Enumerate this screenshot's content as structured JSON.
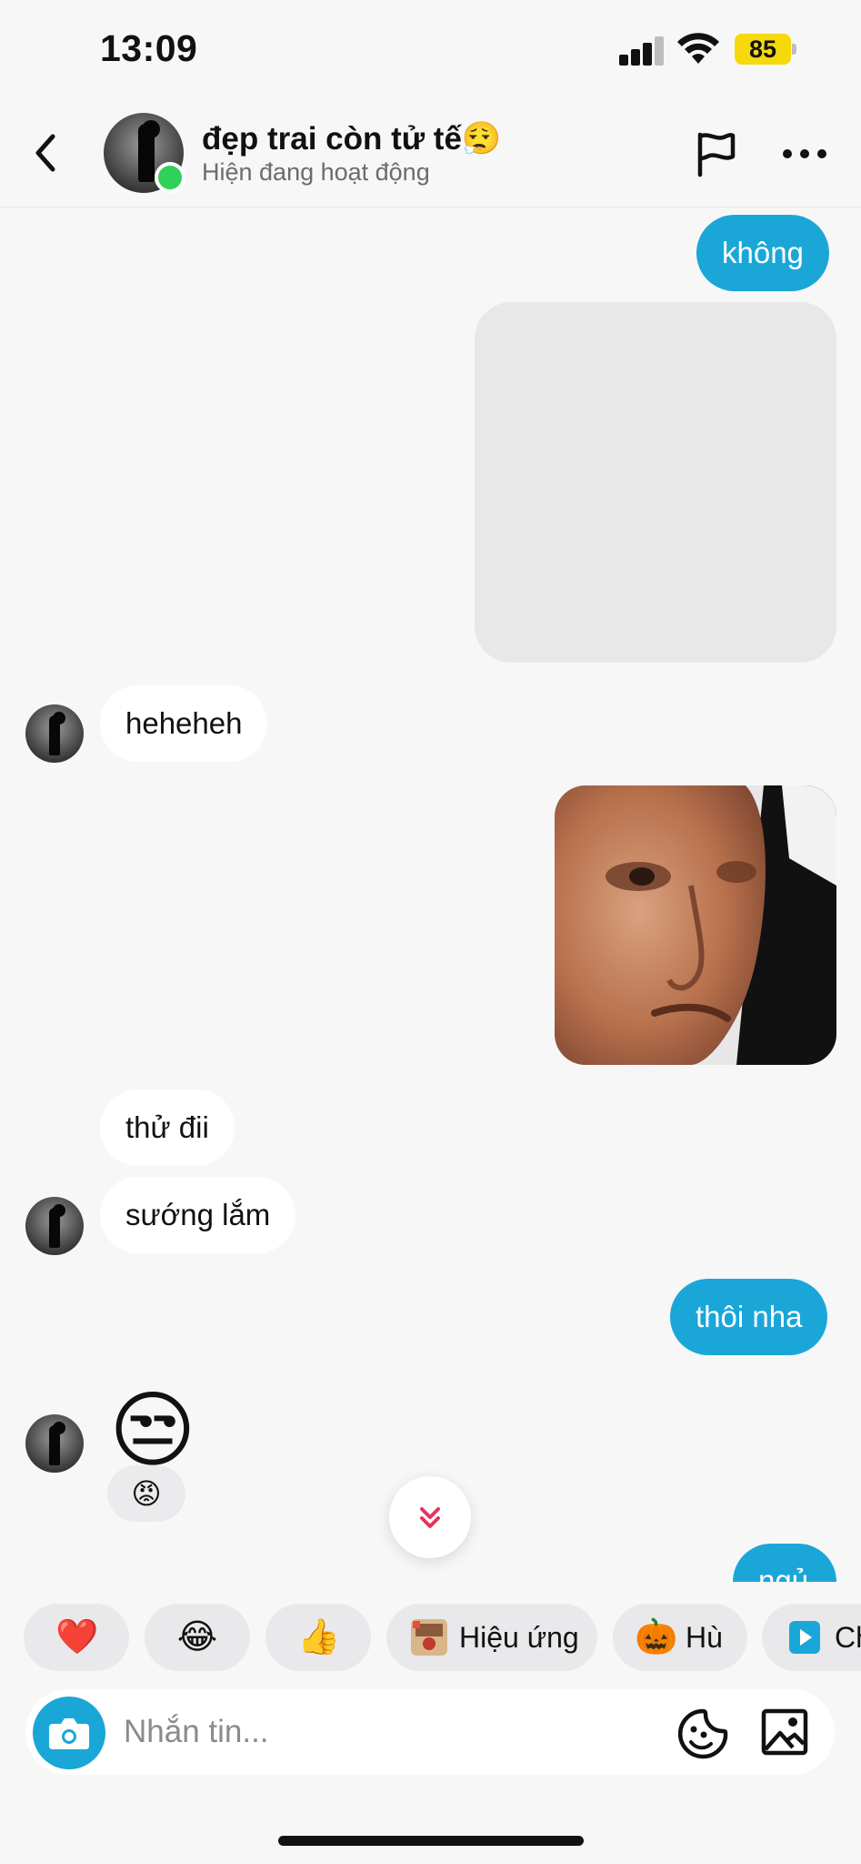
{
  "status_bar": {
    "time": "13:09",
    "battery": "85",
    "battery_color": "#f5d90a",
    "signal_icon": "signal-bars-icon",
    "wifi_icon": "wifi-icon"
  },
  "header": {
    "contact_name": "đẹp trai còn tử tế😮‍💨",
    "contact_status": "Hiện đang hoạt động",
    "online_color": "#2fd158",
    "back_icon": "chevron-left-icon",
    "report_icon": "flag-icon",
    "more_icon": "more-dots-icon"
  },
  "messages": [
    {
      "direction": "out",
      "type": "text",
      "text": "không"
    },
    {
      "direction": "out",
      "type": "media",
      "text": ""
    },
    {
      "direction": "in",
      "type": "text",
      "text": "heheheh"
    },
    {
      "direction": "out",
      "type": "photo",
      "text": ""
    },
    {
      "direction": "in",
      "type": "text",
      "text": "thử đii"
    },
    {
      "direction": "in",
      "type": "text",
      "text": "sướng lắm"
    },
    {
      "direction": "out",
      "type": "text",
      "text": "thôi nha"
    },
    {
      "direction": "in",
      "type": "emoji",
      "text": "😒",
      "reaction": "😡"
    },
    {
      "direction": "out",
      "type": "text",
      "text": "ngủ"
    }
  ],
  "colors": {
    "outgoing_bubble": "#1aa7d8",
    "incoming_bubble": "#ffffff",
    "background": "#f7f7f8",
    "accent_red": "#e8335e"
  },
  "scroll_button_icon": "double-chevron-down-icon",
  "quick_reactions": [
    {
      "icon": "❤️",
      "label": ""
    },
    {
      "icon": "😂",
      "label": ""
    },
    {
      "icon": "👍",
      "label": ""
    },
    {
      "icon": "effect-sticker-icon",
      "label": "Hiệu ứng"
    },
    {
      "icon": "🎃",
      "label": "Hù"
    },
    {
      "icon": "play-icon",
      "label": "Ch"
    }
  ],
  "composer": {
    "placeholder": "Nhắn tin...",
    "camera_icon": "camera-icon",
    "sticker_icon": "sticker-icon",
    "gallery_icon": "gallery-icon"
  }
}
